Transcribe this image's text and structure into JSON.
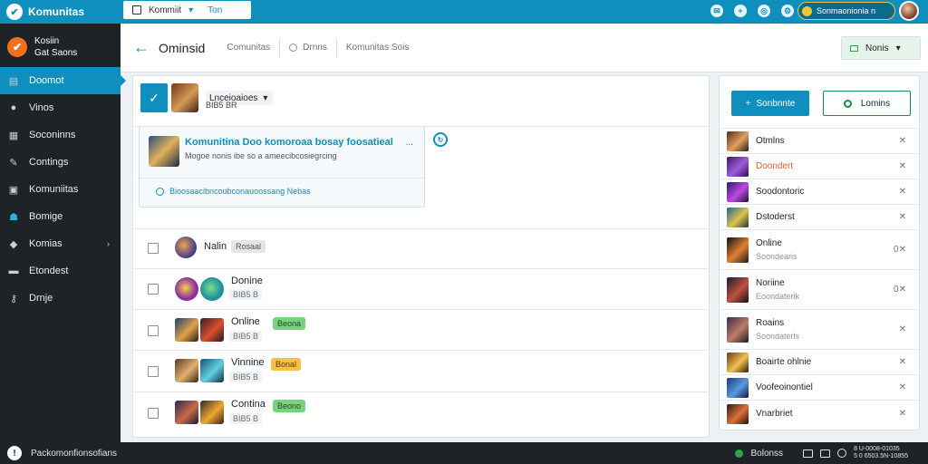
{
  "topbar": {
    "brand": "Komunitas",
    "search_value": "Kommiit",
    "search_flag": "Ton",
    "user_label": "Sonmaonionia n",
    "icons": [
      "chat-icon",
      "plus-icon",
      "globe-icon",
      "settings-icon"
    ]
  },
  "profile": {
    "name": "Kosiin",
    "sub": "Gat Saons"
  },
  "sidebar": {
    "items": [
      {
        "label": "Doomot",
        "icon": "dashboard-icon",
        "active": true
      },
      {
        "label": "Vinos",
        "icon": "user-icon"
      },
      {
        "label": "Soconinns",
        "icon": "document-icon"
      },
      {
        "label": "Contings",
        "icon": "wrench-icon"
      },
      {
        "label": "Komuniitas",
        "icon": "chart-icon"
      },
      {
        "label": "Bomige",
        "icon": "people-icon"
      },
      {
        "label": "Komias",
        "icon": "tag-icon",
        "expandable": true
      },
      {
        "label": "Etondest",
        "icon": "folder-icon"
      },
      {
        "label": "Drnje",
        "icon": "key-icon"
      }
    ]
  },
  "header": {
    "title": "Ominsid",
    "crumb1": "Comunitas",
    "crumb2": "Drnns",
    "crumb3": "Komunitas Sois",
    "action_label": "Nonis"
  },
  "filter": {
    "dropdown_label": "Lnceioaioes",
    "sub": "BIB5 BR"
  },
  "notice": {
    "title": "Komunitina Doo komoroaa bosay foosatieal",
    "more": "...",
    "desc": "Mogoe nonis ibe so a ameecibcosiegrcing",
    "footer": "Bioosaacibncoubconauoossang Nebas"
  },
  "rows": [
    {
      "name": "Nalin",
      "tag": "Rosaal",
      "tag_color": "gray",
      "sub": ""
    },
    {
      "name": "Donine",
      "tag": "",
      "tag_color": "",
      "sub": "BIB5 B"
    },
    {
      "name": "Online",
      "tag": "Beona",
      "tag_color": "green",
      "sub": "BIB5 B"
    },
    {
      "name": "Vinnine",
      "tag": "Bonal",
      "tag_color": "orange",
      "sub": "BIB5 B"
    },
    {
      "name": "Contina",
      "tag": "Beono",
      "tag_color": "green",
      "sub": "BIB5 B"
    }
  ],
  "right_panel": {
    "primary_label": "Sonbnnte",
    "secondary_label": "Lomins",
    "items": [
      {
        "name": "Otmlns",
        "sub": "",
        "x": "✕",
        "highlight": false
      },
      {
        "name": "Doondert",
        "sub": "",
        "x": "✕",
        "highlight": true
      },
      {
        "name": "Soodontoric",
        "sub": "",
        "x": "✕",
        "highlight": false
      },
      {
        "name": "Dstoderst",
        "sub": "",
        "x": "✕",
        "highlight": false
      },
      {
        "name": "Online",
        "sub": "Soondearis",
        "x": "0✕",
        "highlight": false
      },
      {
        "name": "Noriine",
        "sub": "Eoondaterik",
        "x": "0✕",
        "highlight": false
      },
      {
        "name": "Roains",
        "sub": "Soondaterls",
        "x": "✕",
        "highlight": false
      },
      {
        "name": "Boairte ohlnie",
        "sub": "",
        "x": "✕",
        "highlight": false
      },
      {
        "name": "Voofeoinontiel",
        "sub": "",
        "x": "✕",
        "highlight": false
      },
      {
        "name": "Vnarbriet",
        "sub": "",
        "x": "✕",
        "highlight": false
      }
    ]
  },
  "statusbar": {
    "left_text": "Packomonfionsofians",
    "right_text": "Bolonss",
    "clock_line1": "8 U-0008-01035",
    "clock_line2": "5 0 6503.5N-10855"
  },
  "colors": {
    "accent": "#0e8fbd",
    "sidebar": "#1d2327",
    "green": "#2ea44f",
    "orange": "#e2602a"
  }
}
